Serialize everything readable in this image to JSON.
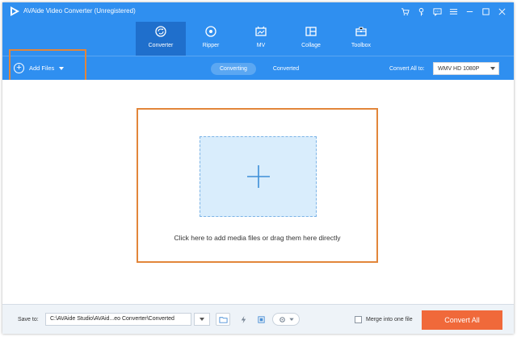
{
  "window": {
    "title": "AVAide Video Converter (Unregistered)"
  },
  "titlebar_icons": [
    "cart-icon",
    "key-icon",
    "chat-icon",
    "menu-icon",
    "minimize-icon",
    "maximize-icon",
    "close-icon"
  ],
  "nav": {
    "items": [
      {
        "label": "Converter",
        "icon": "converter-icon",
        "active": true
      },
      {
        "label": "Ripper",
        "icon": "ripper-icon",
        "active": false
      },
      {
        "label": "MV",
        "icon": "mv-icon",
        "active": false
      },
      {
        "label": "Collage",
        "icon": "collage-icon",
        "active": false
      },
      {
        "label": "Toolbox",
        "icon": "toolbox-icon",
        "active": false
      }
    ]
  },
  "toolbar": {
    "add_files_label": "Add Files",
    "tabs": [
      {
        "label": "Converting",
        "active": true
      },
      {
        "label": "Converted",
        "active": false
      }
    ],
    "convert_all_label": "Convert All to:",
    "format_selected": "WMV HD 1080P"
  },
  "main": {
    "drop_hint": "Click here to add media files or drag them here directly"
  },
  "footer": {
    "save_to_label": "Save to:",
    "path": "C:\\AVAide Studio\\AVAid...eo Converter\\Converted",
    "merge_label": "Merge into one file",
    "convert_all_button": "Convert All"
  },
  "colors": {
    "header_blue": "#2f8ff0",
    "active_nav": "#1f6fcc",
    "highlight_orange": "#e2863a",
    "convert_button": "#f0693a",
    "drop_zone": "#d9edfc"
  }
}
